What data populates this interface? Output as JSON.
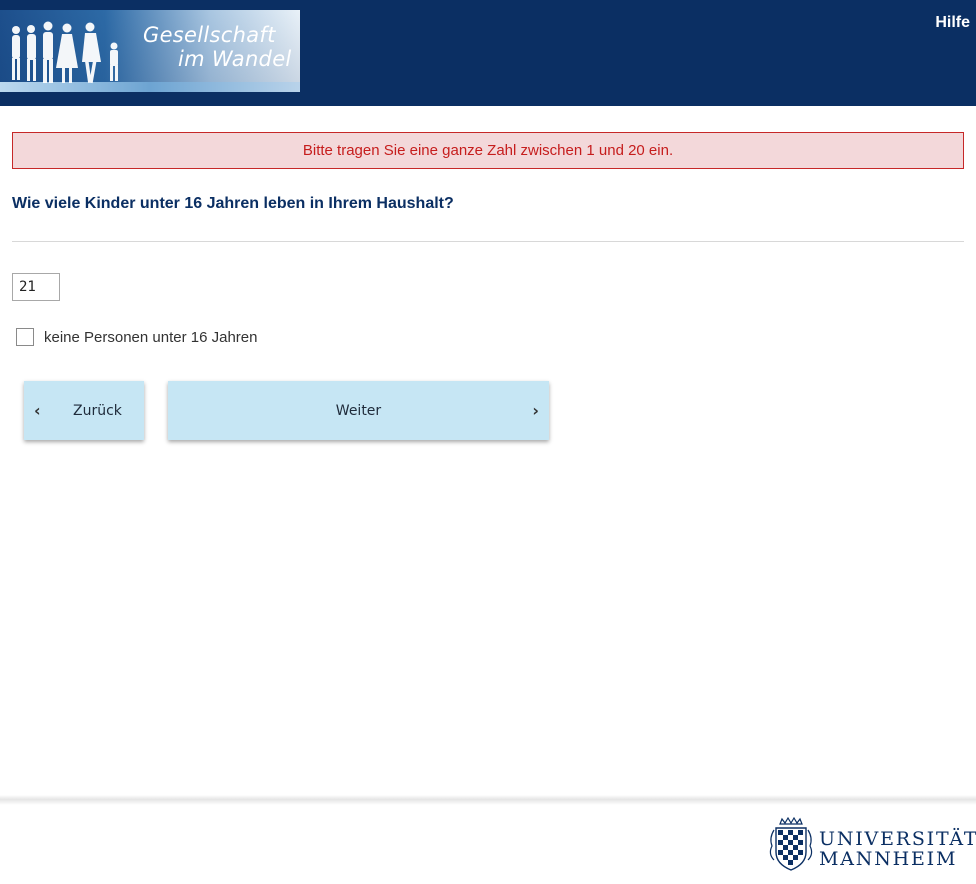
{
  "header": {
    "logo_line1": "Gesellschaft",
    "logo_line2": "im Wandel",
    "help_label": "Hilfe",
    "bg_color": "#0b2f63"
  },
  "error": {
    "message": "Bitte tragen Sie eine ganze Zahl zwischen 1 und 20 ein.",
    "color": "#c61d1d",
    "bg_color": "#f3d8da"
  },
  "question": {
    "text": "Wie viele Kinder unter 16 Jahren leben in Ihrem Haushalt?",
    "input_value": "21",
    "checkbox_label": "keine Personen unter 16 Jahren",
    "checkbox_checked": false
  },
  "nav": {
    "back_label": "Zurück",
    "next_label": "Weiter",
    "back_icon": "chevron-left-icon",
    "next_icon": "chevron-right-icon",
    "button_color": "#c6e6f4"
  },
  "footer": {
    "uni_line1": "UNIVERSITÄT",
    "uni_line2": "MANNHEIM"
  }
}
